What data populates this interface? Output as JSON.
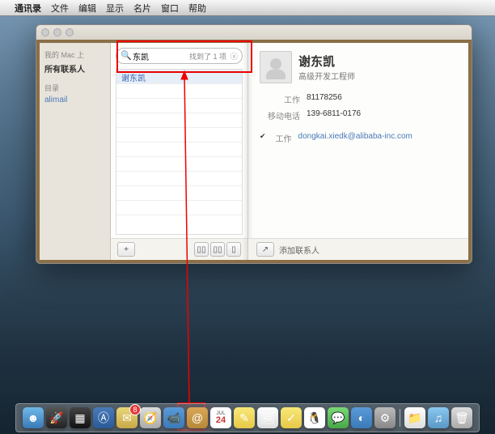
{
  "menubar": {
    "app": "通讯录",
    "items": [
      "文件",
      "编辑",
      "显示",
      "名片",
      "窗口",
      "帮助"
    ]
  },
  "sidebar": {
    "header1": "我的 Mac 上",
    "all_contacts": "所有联系人",
    "header2": "目录",
    "alimail": "alimail"
  },
  "search": {
    "value": "东凯",
    "result_count": "找到了 1 项"
  },
  "list": {
    "item0": "谢东凯"
  },
  "contact": {
    "name": "谢东凯",
    "title": "高级开发工程师",
    "rows": {
      "work_label": "工作",
      "work_val": "81178256",
      "mobile_label": "移动电话",
      "mobile_val": "139-6811-0176",
      "email_label": "工作",
      "email_val": "dongkai.xiedk@alibaba-inc.com"
    }
  },
  "buttons": {
    "add": "+",
    "share": "↗",
    "add_contact": "添加联系人"
  },
  "dock": {
    "calendar_day": "24",
    "mail_badge": "8"
  }
}
